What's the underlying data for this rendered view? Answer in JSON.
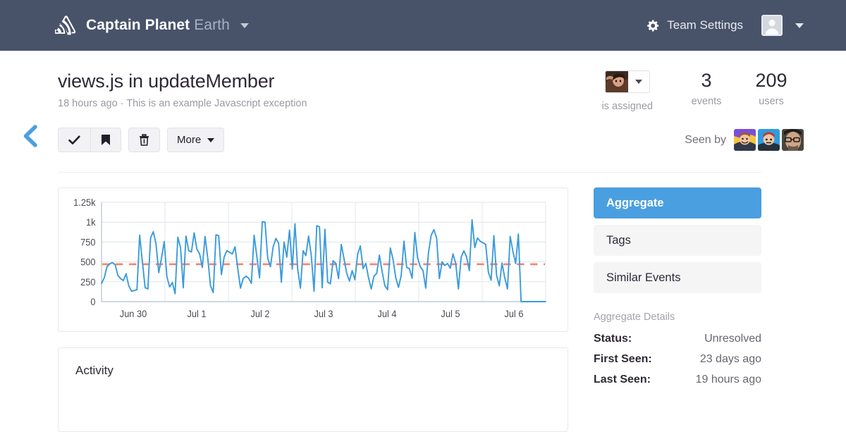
{
  "topnav": {
    "logo_icon": "sentry-logo-icon",
    "brand": "Captain Planet",
    "org": "Earth",
    "org_caret_icon": "chevron-down-icon",
    "team_settings_label": "Team Settings",
    "gear_icon": "gear-icon",
    "user_avatar_icon": "user-avatar-icon",
    "user_caret_icon": "chevron-down-icon",
    "bg_color": "#48536a"
  },
  "group_header": {
    "back_icon": "chevron-left-icon",
    "title": "views.js in updateMember",
    "subtitle": "18 hours ago · This is an example Javascript exception",
    "assignee": {
      "label": "is assigned",
      "avatar_icon": "assignee-avatar-icon",
      "caret_icon": "chevron-down-icon"
    },
    "stats": [
      {
        "value": "3",
        "label": "events"
      },
      {
        "value": "209",
        "label": "users"
      }
    ]
  },
  "actions": {
    "resolve": {
      "label": "",
      "icon": "check-icon"
    },
    "bookmark": {
      "label": "",
      "icon": "bookmark-icon"
    },
    "delete": {
      "label": "",
      "icon": "trash-icon"
    },
    "more": {
      "label": "More",
      "icon": "chevron-down-icon"
    },
    "seen_by_label": "Seen by",
    "seen_by_count": 3
  },
  "sidebar": {
    "tabs": [
      {
        "label": "Aggregate",
        "active": true
      },
      {
        "label": "Tags",
        "active": false
      },
      {
        "label": "Similar Events",
        "active": false
      }
    ],
    "details_title": "Aggregate Details",
    "details": [
      {
        "key": "Status:",
        "value": "Unresolved"
      },
      {
        "key": "First Seen:",
        "value": "23 days ago"
      },
      {
        "key": "Last Seen:",
        "value": "19 hours ago"
      }
    ],
    "active_color": "#4a9fe0"
  },
  "activity": {
    "title": "Activity"
  },
  "chart_data": {
    "type": "line",
    "title": "",
    "xlabel": "",
    "ylabel": "",
    "ylim": [
      0,
      1250
    ],
    "yticks": [
      0,
      250,
      500,
      750,
      1000,
      1250
    ],
    "ytick_labels": [
      "0",
      "250",
      "500",
      "750",
      "1k",
      "1.25k"
    ],
    "categories": [
      "Jun 30",
      "Jul 1",
      "Jul 2",
      "Jul 3",
      "Jul 4",
      "Jul 5",
      "Jul 6"
    ],
    "xtick_index": [
      8,
      32,
      56,
      80,
      104,
      128,
      152
    ],
    "grid": true,
    "legend": false,
    "line_color": "#3a9bdc",
    "threshold": {
      "value": 470,
      "color": "#f4836c",
      "style": "dashed"
    },
    "values": [
      230,
      300,
      440,
      475,
      490,
      465,
      330,
      290,
      265,
      350,
      200,
      130,
      140,
      150,
      835,
      500,
      175,
      160,
      800,
      880,
      725,
      365,
      545,
      755,
      310,
      185,
      240,
      100,
      810,
      680,
      175,
      825,
      640,
      625,
      865,
      660,
      600,
      430,
      820,
      545,
      200,
      115,
      840,
      830,
      340,
      560,
      640,
      620,
      600,
      690,
      420,
      170,
      290,
      320,
      295,
      230,
      835,
      570,
      300,
      1005,
      1000,
      545,
      440,
      690,
      795,
      735,
      245,
      750,
      560,
      900,
      410,
      980,
      410,
      170,
      640,
      580,
      825,
      575,
      130,
      955,
      940,
      175,
      910,
      245,
      225,
      515,
      480,
      290,
      720,
      540,
      355,
      260,
      390,
      275,
      595,
      700,
      415,
      480,
      300,
      160,
      320,
      355,
      585,
      375,
      200,
      150,
      675,
      530,
      300,
      180,
      330,
      760,
      430,
      415,
      295,
      870,
      550,
      440,
      390,
      170,
      615,
      835,
      905,
      800,
      290,
      500,
      455,
      480,
      420,
      600,
      480,
      160,
      560,
      640,
      560,
      390,
      1030,
      680,
      800,
      760,
      740,
      720,
      370,
      270,
      830,
      330,
      200,
      485,
      300,
      160,
      820,
      630,
      480,
      850,
      0,
      0,
      0,
      0,
      0,
      0,
      0,
      0,
      0,
      0
    ]
  }
}
